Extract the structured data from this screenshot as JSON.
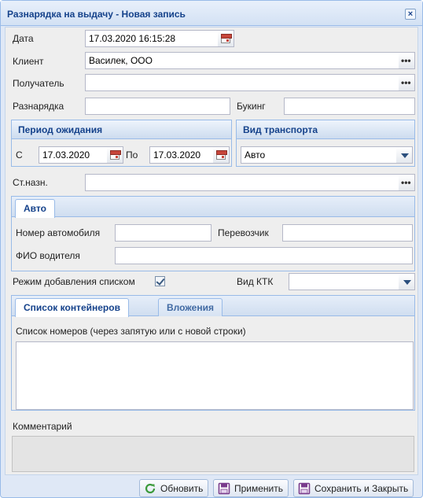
{
  "window": {
    "title": "Разнарядка на выдачу - Новая запись"
  },
  "fields": {
    "date_label": "Дата",
    "date_value": "17.03.2020 16:15:28",
    "client_label": "Клиент",
    "client_value": "Василек, ООО",
    "recipient_label": "Получатель",
    "recipient_value": "",
    "allocation_label": "Разнарядка",
    "allocation_value": "",
    "booking_label": "Букинг",
    "booking_value": "",
    "station_label": "Ст.назн.",
    "station_value": ""
  },
  "waiting_period": {
    "title": "Период ожидания",
    "from_label": "С",
    "from_value": "17.03.2020",
    "to_label": "По",
    "to_value": "17.03.2020"
  },
  "transport": {
    "title": "Вид транспорта",
    "selected": "Авто"
  },
  "auto_tab": {
    "tab_label": "Авто",
    "car_number_label": "Номер автомобиля",
    "car_number_value": "",
    "carrier_label": "Перевозчик",
    "carrier_value": "",
    "driver_label": "ФИО водителя",
    "driver_value": ""
  },
  "list_mode": {
    "label": "Режим добавления списком",
    "checked": true,
    "ktk_label": "Вид КТК",
    "ktk_value": ""
  },
  "containers_tabs": {
    "tabs": [
      "Список контейнеров",
      "Вложения"
    ],
    "hint": "Список номеров (через запятую или с новой строки)"
  },
  "comment": {
    "label": "Комментарий"
  },
  "footer": {
    "refresh_label": "Обновить",
    "apply_label": "Применить",
    "save_close_label": "Сохранить и Закрыть"
  },
  "icons": {
    "close": "close-icon",
    "calendar": "calendar-icon",
    "ellipsis": "ellipsis-icon",
    "dropdown": "chevron-down-icon",
    "refresh": "refresh-icon",
    "save": "save-icon"
  },
  "colors": {
    "title_text": "#15428b",
    "window_border": "#99bbe8",
    "refresh_icon": "#3b9a3b",
    "save_icon": "#7a3c8c"
  }
}
